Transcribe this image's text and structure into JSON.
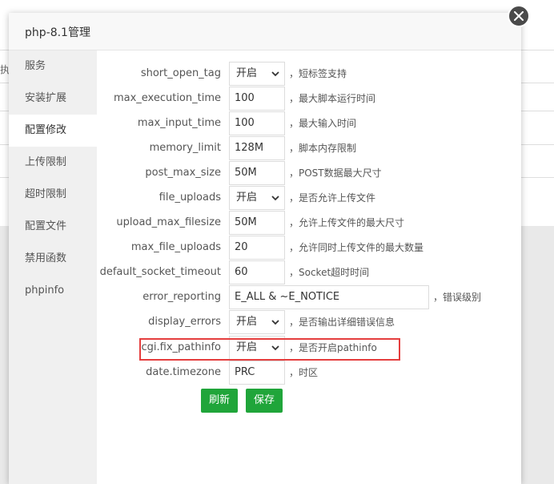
{
  "background": {
    "fragment": "执"
  },
  "dialog": {
    "title": "php-8.1管理"
  },
  "sidebar": {
    "items": [
      {
        "label": "服务"
      },
      {
        "label": "安装扩展"
      },
      {
        "label": "配置修改",
        "active": true
      },
      {
        "label": "上传限制"
      },
      {
        "label": "超时限制"
      },
      {
        "label": "配置文件"
      },
      {
        "label": "禁用函数"
      },
      {
        "label": "phpinfo"
      }
    ]
  },
  "settings": [
    {
      "name": "short_open_tag",
      "type": "select",
      "value": "开启",
      "desc": "，短标签支持"
    },
    {
      "name": "max_execution_time",
      "type": "input",
      "value": "100",
      "desc": "，最大脚本运行时间"
    },
    {
      "name": "max_input_time",
      "type": "input",
      "value": "100",
      "desc": "，最大输入时间"
    },
    {
      "name": "memory_limit",
      "type": "input",
      "value": "128M",
      "desc": "，脚本内存限制"
    },
    {
      "name": "post_max_size",
      "type": "input",
      "value": "50M",
      "desc": "，POST数据最大尺寸"
    },
    {
      "name": "file_uploads",
      "type": "select",
      "value": "开启",
      "desc": "，是否允许上传文件"
    },
    {
      "name": "upload_max_filesize",
      "type": "input",
      "value": "50M",
      "desc": "，允许上传文件的最大尺寸"
    },
    {
      "name": "max_file_uploads",
      "type": "input",
      "value": "20",
      "desc": "，允许同时上传文件的最大数量"
    },
    {
      "name": "default_socket_timeout",
      "type": "input",
      "value": "60",
      "desc": "，Socket超时时间"
    },
    {
      "name": "error_reporting",
      "type": "input",
      "value": "E_ALL & ~E_NOTICE",
      "desc": "，错误级别"
    },
    {
      "name": "display_errors",
      "type": "select",
      "value": "开启",
      "desc": "，是否输出详细错误信息"
    },
    {
      "name": "cgi.fix_pathinfo",
      "type": "select",
      "value": "开启",
      "desc": "，是否开启pathinfo"
    },
    {
      "name": "date.timezone",
      "type": "input",
      "value": "PRC",
      "desc": "，时区"
    }
  ],
  "buttons": {
    "refresh": "刷新",
    "save": "保存"
  },
  "colors": {
    "primary": "#20a53a",
    "highlight": "#e53e3e"
  },
  "icons": {
    "close": "close-icon",
    "select_arrow": "chevron-down-icon"
  }
}
